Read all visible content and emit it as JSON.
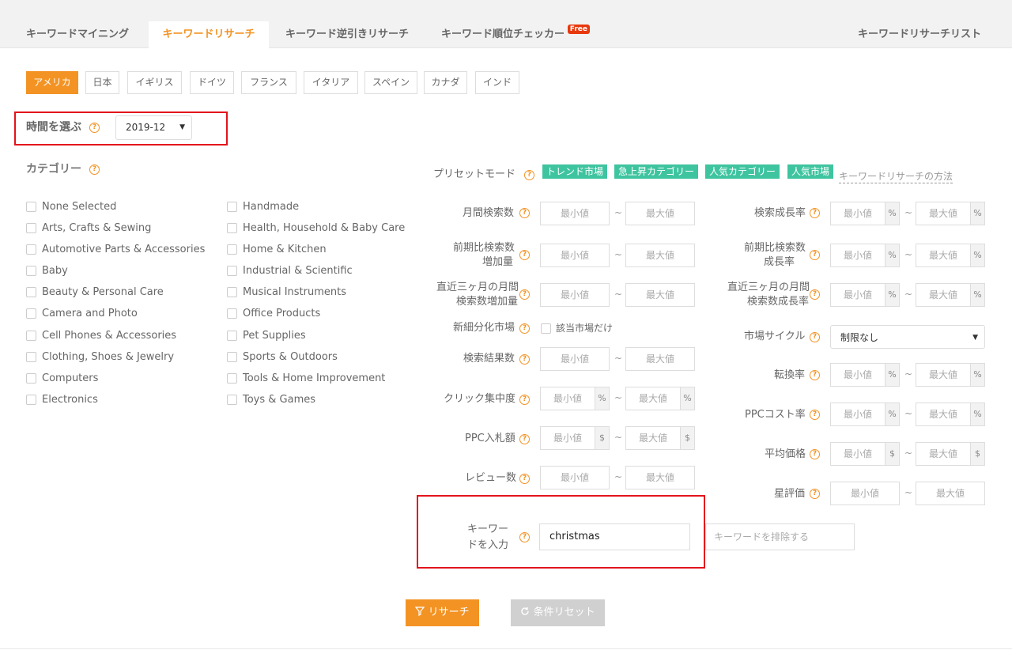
{
  "tabs": [
    {
      "label": "キーワードマイニング"
    },
    {
      "label": "キーワードリサーチ"
    },
    {
      "label": "キーワード逆引きリサーチ"
    },
    {
      "label": "キーワード順位チェッカー",
      "badge": "Free"
    }
  ],
  "right_tab": "キーワードリサーチリスト",
  "countries": [
    "アメリカ",
    "日本",
    "イギリス",
    "ドイツ",
    "フランス",
    "イタリア",
    "スペイン",
    "カナダ",
    "インド"
  ],
  "time": {
    "label": "時間を選ぶ",
    "value": "2019-12"
  },
  "category": {
    "label": "カテゴリー",
    "col1": [
      "None Selected",
      "Arts, Crafts & Sewing",
      "Automotive Parts & Accessories",
      "Baby",
      "Beauty & Personal Care",
      "Camera and Photo",
      "Cell Phones & Accessories",
      "Clothing, Shoes & Jewelry",
      "Computers",
      "Electronics"
    ],
    "col2": [
      "Handmade",
      "Health, Household & Baby Care",
      "Home & Kitchen",
      "Industrial & Scientific",
      "Musical Instruments",
      "Office Products",
      "Pet Supplies",
      "Sports & Outdoors",
      "Tools & Home Improvement",
      "Toys & Games"
    ]
  },
  "preset": {
    "label": "プリセットモード",
    "tags": [
      "トレンド市場",
      "急上昇カテゴリー",
      "人気カテゴリー",
      "人気市場"
    ],
    "link": "キーワードリサーチの方法"
  },
  "placeholders": {
    "min": "最小値",
    "max": "最大値",
    "tilde": "~"
  },
  "filters": {
    "monthly": "月間検索数",
    "increase_1": "前期比検索数",
    "increase_2": "増加量",
    "recent_1": "直近三ヶ月の月間",
    "recent_2": "検索数増加量",
    "niche": "新細分化市場",
    "niche_cb": "該当市場だけ",
    "results": "検索結果数",
    "click": "クリック集中度",
    "ppc_bid": "PPC入札額",
    "reviews": "レビュー数",
    "growth": "検索成長率",
    "growth2_1": "前期比検索数",
    "growth2_2": "成長率",
    "recent_growth_1": "直近三ヶ月の月間",
    "recent_growth_2": "検索数成長率",
    "cycle": "市場サイクル",
    "cycle_value": "制限なし",
    "conversion": "転換率",
    "ppc_cost": "PPCコスト率",
    "avg_price": "平均価格",
    "rating": "星評価"
  },
  "units": {
    "percent": "%",
    "dollar": "$"
  },
  "keyword": {
    "label_1": "キーワー",
    "label_2": "ドを入力",
    "value": "christmas",
    "exclude_placeholder": "キーワードを排除する"
  },
  "buttons": {
    "research": "リサーチ",
    "reset": "条件リセット"
  },
  "colors": {
    "accent": "#f39324",
    "tag": "#3fc4a0",
    "highlight": "#e3141b"
  }
}
